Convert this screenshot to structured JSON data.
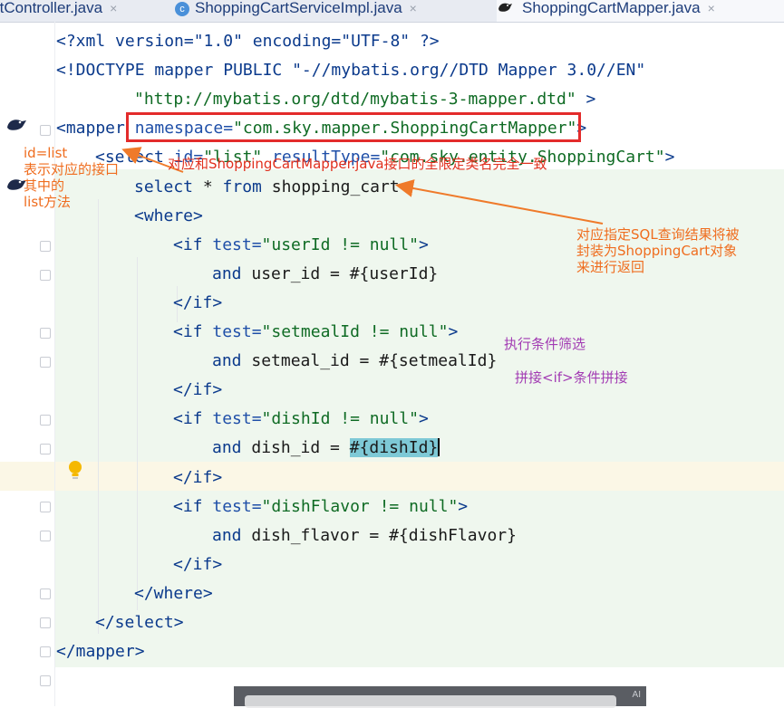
{
  "tabs": [
    {
      "label": "rtController.java",
      "close": "×",
      "icon": "",
      "active": false
    },
    {
      "label": "ShoppingCartServiceImpl.java",
      "close": "×",
      "icon": "c",
      "active": false
    },
    {
      "label": "ShoppingCartMapper.java",
      "close": "×",
      "icon": "mybatis-bird-icon",
      "active": true
    }
  ],
  "code": [
    {
      "indent": 0,
      "parts": [
        [
          "tg",
          "<?xml version=\"1.0\" encoding=\"UTF-8\" ?>"
        ]
      ]
    },
    {
      "indent": 0,
      "parts": [
        [
          "tg",
          "<!DOCTYPE mapper PUBLIC \"-//mybatis.org//DTD Mapper 3.0//EN\""
        ]
      ]
    },
    {
      "indent": 2,
      "parts": [
        [
          "st",
          "\"http://mybatis.org/dtd/mybatis-3-mapper.dtd\""
        ],
        [
          "tg",
          " >"
        ]
      ]
    },
    {
      "indent": 0,
      "parts": [
        [
          "tg",
          "<mapper "
        ],
        [
          "at",
          "namespace="
        ],
        [
          "st",
          "\"com.sky.mapper.ShoppingCartMapper\""
        ],
        [
          "tg",
          ">"
        ]
      ]
    },
    {
      "indent": 1,
      "parts": [
        [
          "tg",
          "<select "
        ],
        [
          "at",
          "id="
        ],
        [
          "st",
          "\"list\" "
        ],
        [
          "at",
          "resultType="
        ],
        [
          "st",
          "\"com.sky.entity.ShoppingCart\""
        ],
        [
          "tg",
          ">"
        ]
      ]
    },
    {
      "indent": 2,
      "parts": [
        [
          "kw",
          "select"
        ],
        [
          "",
          "* "
        ],
        [
          "kw",
          "from"
        ],
        [
          "",
          " shopping_cart"
        ]
      ]
    },
    {
      "indent": 2,
      "parts": [
        [
          "tg",
          "<where>"
        ]
      ]
    },
    {
      "indent": 3,
      "parts": [
        [
          "tg",
          "<if "
        ],
        [
          "at",
          "test="
        ],
        [
          "st",
          "\"userId != null\""
        ],
        [
          "tg",
          ">"
        ]
      ]
    },
    {
      "indent": 4,
      "parts": [
        [
          "kw",
          "and"
        ],
        [
          "",
          " user_id = #{userId}"
        ]
      ]
    },
    {
      "indent": 3,
      "parts": [
        [
          "tg",
          "</if>"
        ]
      ]
    },
    {
      "indent": 3,
      "parts": [
        [
          "tg",
          "<if "
        ],
        [
          "at",
          "test="
        ],
        [
          "st",
          "\"setmealId != null\""
        ],
        [
          "tg",
          ">"
        ]
      ]
    },
    {
      "indent": 4,
      "parts": [
        [
          "kw",
          "and"
        ],
        [
          "",
          " setmeal_id = #{setmealId}"
        ]
      ]
    },
    {
      "indent": 3,
      "parts": [
        [
          "tg",
          "</if>"
        ]
      ]
    },
    {
      "indent": 3,
      "parts": [
        [
          "tg",
          "<if "
        ],
        [
          "at",
          "test="
        ],
        [
          "st",
          "\"dishId != null\""
        ],
        [
          "tg",
          ">"
        ]
      ]
    },
    {
      "indent": 4,
      "parts": [
        [
          "kw",
          "and"
        ],
        [
          "",
          " dish_id = "
        ],
        [
          "hl",
          "#{dishId}"
        ],
        [
          "caret",
          ""
        ]
      ]
    },
    {
      "indent": 3,
      "parts": [
        [
          "tg",
          "</if>"
        ]
      ]
    },
    {
      "indent": 3,
      "parts": [
        [
          "tg",
          "<if "
        ],
        [
          "at",
          "test="
        ],
        [
          "st",
          "\"dishFlavor != null\""
        ],
        [
          "tg",
          ">"
        ]
      ]
    },
    {
      "indent": 4,
      "parts": [
        [
          "kw",
          "and"
        ],
        [
          "",
          " dish_flavor = #{dishFlavor}"
        ]
      ]
    },
    {
      "indent": 3,
      "parts": [
        [
          "tg",
          "</if>"
        ]
      ]
    },
    {
      "indent": 2,
      "parts": [
        [
          "tg",
          "</where>"
        ]
      ]
    },
    {
      "indent": 1,
      "parts": [
        [
          "tg",
          "</select>"
        ]
      ]
    },
    {
      "indent": 0,
      "parts": [
        [
          "tg",
          "</mapper>"
        ]
      ]
    }
  ],
  "annotations": {
    "id_note": [
      "id=list",
      "表示对应的接口",
      "其中的",
      "list方法"
    ],
    "namespace_note": "对应和ShoppingCartMapper.java接口的全限定类名完全一致",
    "result_note": [
      "对应指定SQL查询结果将被",
      "封装为ShoppingCart对象",
      "来进行返回"
    ],
    "filter_note": "执行条件筛选",
    "concat_note": "拼接<if>条件拼接"
  },
  "overlay": {
    "ai_label": "AI"
  },
  "colors": {
    "highlight_box": "#e32b2b",
    "arrow": "#ef7a2a",
    "annotation_orange": "#ef6d1f",
    "annotation_purple": "#a23bb3"
  }
}
